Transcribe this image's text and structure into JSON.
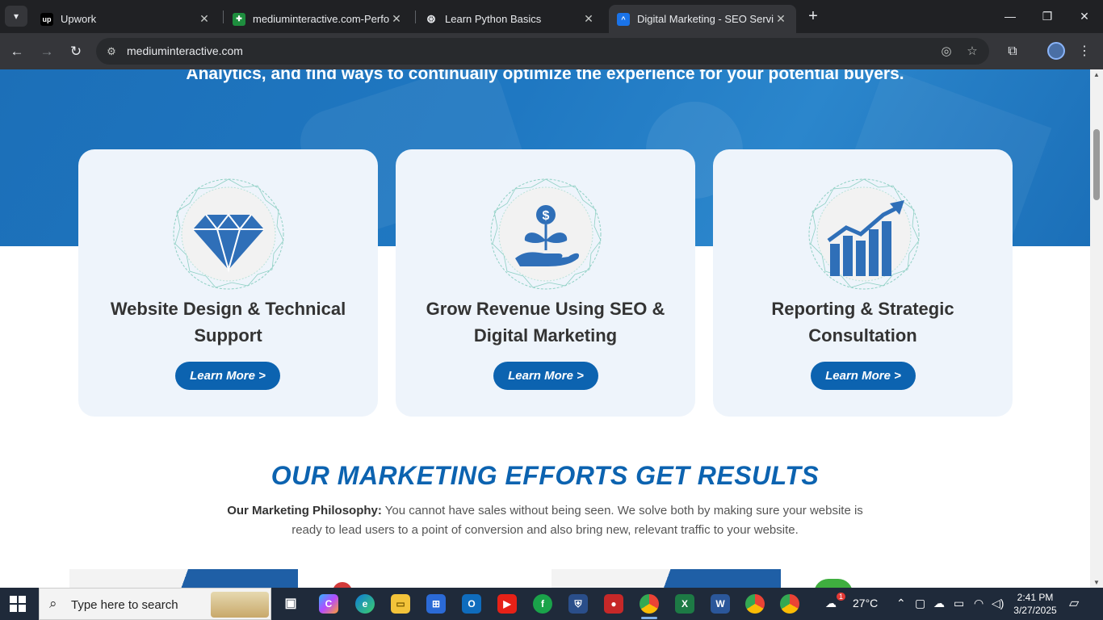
{
  "browser": {
    "tabs": [
      {
        "title": "Upwork",
        "favicon": "upwork-icon",
        "active": false
      },
      {
        "title": "mediuminteractive.com-Performance",
        "favicon": "sheets-icon",
        "active": false
      },
      {
        "title": "Learn Python Basics",
        "favicon": "openai-icon",
        "active": false
      },
      {
        "title": "Digital Marketing - SEO Services",
        "favicon": "site-icon",
        "active": true
      }
    ],
    "url": "mediuminteractive.com"
  },
  "page": {
    "hero_text": "Analytics, and find ways to continually optimize the experience for your potential buyers.",
    "cards": [
      {
        "title": "Website Design & Technical Support",
        "button": "Learn More >",
        "icon": "diamond-icon"
      },
      {
        "title": "Grow Revenue Using SEO & Digital Marketing",
        "button": "Learn More >",
        "icon": "money-plant-icon"
      },
      {
        "title": "Reporting & Strategic Consultation",
        "button": "Learn More >",
        "icon": "growth-chart-icon"
      }
    ],
    "section_title": "OUR MARKETING EFFORTS GET RESULTS",
    "philosophy_label": "Our Marketing Philosophy:",
    "philosophy_text": "You cannot have sales without being seen. We solve both by making sure your website is ready to lead users to a point of conversion and also bring new, relevant traffic to your website."
  },
  "taskbar": {
    "search_placeholder": "Type here to search",
    "weather": "27°C",
    "weather_badge": "1",
    "time": "2:41 PM",
    "date": "3/27/2025"
  },
  "colors": {
    "brand_blue": "#0c63b0",
    "hero_blue": "#1f78c2",
    "card_bg": "#eef4fb"
  }
}
